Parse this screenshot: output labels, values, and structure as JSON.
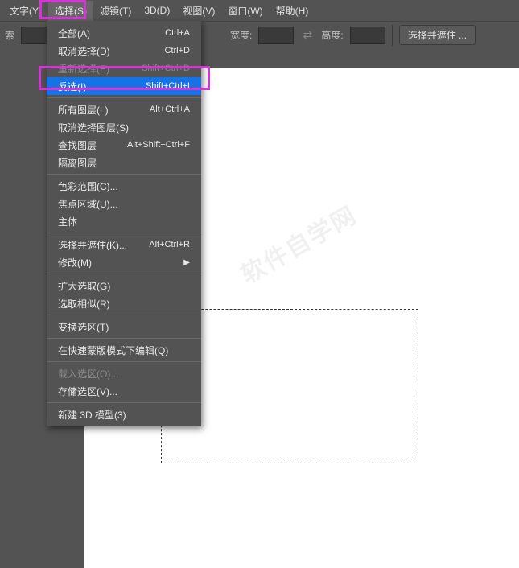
{
  "menubar": {
    "items": [
      {
        "label": "文字(Y)"
      },
      {
        "label": "选择(S)"
      },
      {
        "label": "滤镜(T)"
      },
      {
        "label": "3D(D)"
      },
      {
        "label": "视图(V)"
      },
      {
        "label": "窗口(W)"
      },
      {
        "label": "帮助(H)"
      }
    ]
  },
  "toolbar": {
    "search_label": "索",
    "width_label": "宽度:",
    "height_label": "高度:",
    "mask_button": "选择并遮住 ..."
  },
  "dropdown": {
    "items": [
      {
        "label": "全部(A)",
        "shortcut": "Ctrl+A",
        "type": "item"
      },
      {
        "label": "取消选择(D)",
        "shortcut": "Ctrl+D",
        "type": "item"
      },
      {
        "label": "重新选择(E)",
        "shortcut": "Shift+Ctrl+D",
        "type": "item",
        "disabled": true
      },
      {
        "label": "反选(I)",
        "shortcut": "Shift+Ctrl+I",
        "type": "item",
        "highlight": true
      },
      {
        "type": "sep"
      },
      {
        "label": "所有图层(L)",
        "shortcut": "Alt+Ctrl+A",
        "type": "item"
      },
      {
        "label": "取消选择图层(S)",
        "shortcut": "",
        "type": "item"
      },
      {
        "label": "查找图层",
        "shortcut": "Alt+Shift+Ctrl+F",
        "type": "item"
      },
      {
        "label": "隔离图层",
        "shortcut": "",
        "type": "item"
      },
      {
        "type": "sep"
      },
      {
        "label": "色彩范围(C)...",
        "shortcut": "",
        "type": "item"
      },
      {
        "label": "焦点区域(U)...",
        "shortcut": "",
        "type": "item"
      },
      {
        "label": "主体",
        "shortcut": "",
        "type": "item"
      },
      {
        "type": "sep"
      },
      {
        "label": "选择并遮住(K)...",
        "shortcut": "Alt+Ctrl+R",
        "type": "item"
      },
      {
        "label": "修改(M)",
        "shortcut": "",
        "type": "item",
        "submenu": true
      },
      {
        "type": "sep"
      },
      {
        "label": "扩大选取(G)",
        "shortcut": "",
        "type": "item"
      },
      {
        "label": "选取相似(R)",
        "shortcut": "",
        "type": "item"
      },
      {
        "type": "sep"
      },
      {
        "label": "变换选区(T)",
        "shortcut": "",
        "type": "item"
      },
      {
        "type": "sep"
      },
      {
        "label": "在快速蒙版模式下编辑(Q)",
        "shortcut": "",
        "type": "item"
      },
      {
        "type": "sep"
      },
      {
        "label": "载入选区(O)...",
        "shortcut": "",
        "type": "item",
        "disabled": true
      },
      {
        "label": "存储选区(V)...",
        "shortcut": "",
        "type": "item"
      },
      {
        "type": "sep"
      },
      {
        "label": "新建 3D 模型(3)",
        "shortcut": "",
        "type": "item"
      }
    ]
  },
  "watermark": "软件自学网"
}
